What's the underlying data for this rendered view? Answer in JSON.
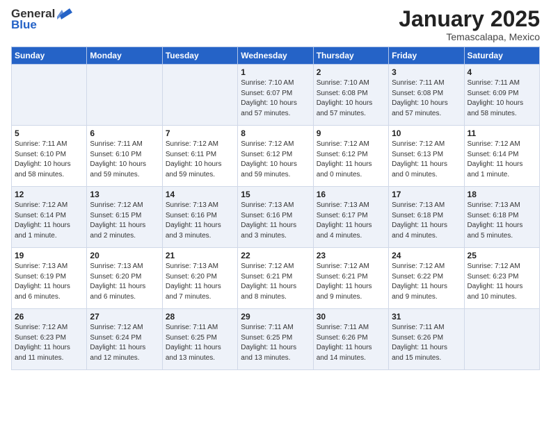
{
  "logo": {
    "general": "General",
    "blue": "Blue"
  },
  "header": {
    "month": "January 2025",
    "location": "Temascalapa, Mexico"
  },
  "weekdays": [
    "Sunday",
    "Monday",
    "Tuesday",
    "Wednesday",
    "Thursday",
    "Friday",
    "Saturday"
  ],
  "weeks": [
    [
      {
        "day": null,
        "info": null
      },
      {
        "day": null,
        "info": null
      },
      {
        "day": null,
        "info": null
      },
      {
        "day": "1",
        "info": "Sunrise: 7:10 AM\nSunset: 6:07 PM\nDaylight: 10 hours\nand 57 minutes."
      },
      {
        "day": "2",
        "info": "Sunrise: 7:10 AM\nSunset: 6:08 PM\nDaylight: 10 hours\nand 57 minutes."
      },
      {
        "day": "3",
        "info": "Sunrise: 7:11 AM\nSunset: 6:08 PM\nDaylight: 10 hours\nand 57 minutes."
      },
      {
        "day": "4",
        "info": "Sunrise: 7:11 AM\nSunset: 6:09 PM\nDaylight: 10 hours\nand 58 minutes."
      }
    ],
    [
      {
        "day": "5",
        "info": "Sunrise: 7:11 AM\nSunset: 6:10 PM\nDaylight: 10 hours\nand 58 minutes."
      },
      {
        "day": "6",
        "info": "Sunrise: 7:11 AM\nSunset: 6:10 PM\nDaylight: 10 hours\nand 59 minutes."
      },
      {
        "day": "7",
        "info": "Sunrise: 7:12 AM\nSunset: 6:11 PM\nDaylight: 10 hours\nand 59 minutes."
      },
      {
        "day": "8",
        "info": "Sunrise: 7:12 AM\nSunset: 6:12 PM\nDaylight: 10 hours\nand 59 minutes."
      },
      {
        "day": "9",
        "info": "Sunrise: 7:12 AM\nSunset: 6:12 PM\nDaylight: 11 hours\nand 0 minutes."
      },
      {
        "day": "10",
        "info": "Sunrise: 7:12 AM\nSunset: 6:13 PM\nDaylight: 11 hours\nand 0 minutes."
      },
      {
        "day": "11",
        "info": "Sunrise: 7:12 AM\nSunset: 6:14 PM\nDaylight: 11 hours\nand 1 minute."
      }
    ],
    [
      {
        "day": "12",
        "info": "Sunrise: 7:12 AM\nSunset: 6:14 PM\nDaylight: 11 hours\nand 1 minute."
      },
      {
        "day": "13",
        "info": "Sunrise: 7:12 AM\nSunset: 6:15 PM\nDaylight: 11 hours\nand 2 minutes."
      },
      {
        "day": "14",
        "info": "Sunrise: 7:13 AM\nSunset: 6:16 PM\nDaylight: 11 hours\nand 3 minutes."
      },
      {
        "day": "15",
        "info": "Sunrise: 7:13 AM\nSunset: 6:16 PM\nDaylight: 11 hours\nand 3 minutes."
      },
      {
        "day": "16",
        "info": "Sunrise: 7:13 AM\nSunset: 6:17 PM\nDaylight: 11 hours\nand 4 minutes."
      },
      {
        "day": "17",
        "info": "Sunrise: 7:13 AM\nSunset: 6:18 PM\nDaylight: 11 hours\nand 4 minutes."
      },
      {
        "day": "18",
        "info": "Sunrise: 7:13 AM\nSunset: 6:18 PM\nDaylight: 11 hours\nand 5 minutes."
      }
    ],
    [
      {
        "day": "19",
        "info": "Sunrise: 7:13 AM\nSunset: 6:19 PM\nDaylight: 11 hours\nand 6 minutes."
      },
      {
        "day": "20",
        "info": "Sunrise: 7:13 AM\nSunset: 6:20 PM\nDaylight: 11 hours\nand 6 minutes."
      },
      {
        "day": "21",
        "info": "Sunrise: 7:13 AM\nSunset: 6:20 PM\nDaylight: 11 hours\nand 7 minutes."
      },
      {
        "day": "22",
        "info": "Sunrise: 7:12 AM\nSunset: 6:21 PM\nDaylight: 11 hours\nand 8 minutes."
      },
      {
        "day": "23",
        "info": "Sunrise: 7:12 AM\nSunset: 6:21 PM\nDaylight: 11 hours\nand 9 minutes."
      },
      {
        "day": "24",
        "info": "Sunrise: 7:12 AM\nSunset: 6:22 PM\nDaylight: 11 hours\nand 9 minutes."
      },
      {
        "day": "25",
        "info": "Sunrise: 7:12 AM\nSunset: 6:23 PM\nDaylight: 11 hours\nand 10 minutes."
      }
    ],
    [
      {
        "day": "26",
        "info": "Sunrise: 7:12 AM\nSunset: 6:23 PM\nDaylight: 11 hours\nand 11 minutes."
      },
      {
        "day": "27",
        "info": "Sunrise: 7:12 AM\nSunset: 6:24 PM\nDaylight: 11 hours\nand 12 minutes."
      },
      {
        "day": "28",
        "info": "Sunrise: 7:11 AM\nSunset: 6:25 PM\nDaylight: 11 hours\nand 13 minutes."
      },
      {
        "day": "29",
        "info": "Sunrise: 7:11 AM\nSunset: 6:25 PM\nDaylight: 11 hours\nand 13 minutes."
      },
      {
        "day": "30",
        "info": "Sunrise: 7:11 AM\nSunset: 6:26 PM\nDaylight: 11 hours\nand 14 minutes."
      },
      {
        "day": "31",
        "info": "Sunrise: 7:11 AM\nSunset: 6:26 PM\nDaylight: 11 hours\nand 15 minutes."
      },
      {
        "day": null,
        "info": null
      }
    ]
  ]
}
